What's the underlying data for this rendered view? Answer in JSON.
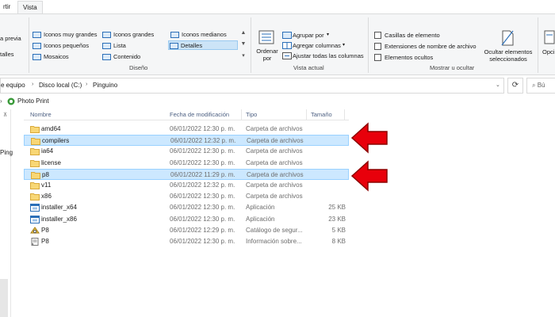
{
  "tabs": [
    "rtir",
    "Vista"
  ],
  "ribbon": {
    "panes": {
      "preview": "a previa",
      "details": "talles"
    },
    "layouts": [
      "Iconos muy grandes",
      "Iconos grandes",
      "Iconos medianos",
      "Iconos pequeños",
      "Lista",
      "Detalles",
      "Mosaicos",
      "Contenido"
    ],
    "layout_selected": "Detalles",
    "group_layout": "Diseño",
    "sort_label": "Ordenar por",
    "group_by": "Agrupar por",
    "add_columns": "Agregar columnas",
    "fit_columns": "Ajustar todas las columnas",
    "group_view": "Vista actual",
    "checkboxes": [
      "Casillas de elemento",
      "Extensiones de nombre de archivo",
      "Elementos ocultos"
    ],
    "hide_selected": "Ocultar elementos seleccionados",
    "group_show": "Mostrar u ocultar",
    "options": "Opci"
  },
  "address": {
    "crumbs": [
      "e equipo",
      "Disco local (C:)",
      "Pinguino"
    ],
    "search_placeholder": "Bú"
  },
  "quick_access": "Photo Print",
  "nav": {
    "partial_label": "Ping"
  },
  "columns": {
    "name": "Nombre",
    "date": "Fecha de modificación",
    "type": "Tipo",
    "size": "Tamaño"
  },
  "files": [
    {
      "name": "amd64",
      "date": "06/01/2022 12:30 p. m.",
      "type": "Carpeta de archivos",
      "size": "",
      "icon": "folder-icon",
      "selected": false
    },
    {
      "name": "compilers",
      "date": "06/01/2022 12:32 p. m.",
      "type": "Carpeta de archivos",
      "size": "",
      "icon": "folder-icon",
      "selected": true
    },
    {
      "name": "ia64",
      "date": "06/01/2022 12:30 p. m.",
      "type": "Carpeta de archivos",
      "size": "",
      "icon": "folder-icon",
      "selected": false
    },
    {
      "name": "license",
      "date": "06/01/2022 12:30 p. m.",
      "type": "Carpeta de archivos",
      "size": "",
      "icon": "folder-icon",
      "selected": false
    },
    {
      "name": "p8",
      "date": "06/01/2022 11:29 p. m.",
      "type": "Carpeta de archivos",
      "size": "",
      "icon": "folder-icon",
      "selected": true
    },
    {
      "name": "v11",
      "date": "06/01/2022 12:32 p. m.",
      "type": "Carpeta de archivos",
      "size": "",
      "icon": "folder-icon",
      "selected": false
    },
    {
      "name": "x86",
      "date": "06/01/2022 12:30 p. m.",
      "type": "Carpeta de archivos",
      "size": "",
      "icon": "folder-icon",
      "selected": false
    },
    {
      "name": "installer_x64",
      "date": "06/01/2022 12:30 p. m.",
      "type": "Aplicación",
      "size": "25 KB",
      "icon": "application-icon",
      "selected": false
    },
    {
      "name": "installer_x86",
      "date": "06/01/2022 12:30 p. m.",
      "type": "Aplicación",
      "size": "23 KB",
      "icon": "application-icon",
      "selected": false
    },
    {
      "name": "P8",
      "date": "06/01/2022 12:29 p. m.",
      "type": "Catálogo de segur...",
      "size": "5 KB",
      "icon": "security-catalog-icon",
      "selected": false
    },
    {
      "name": "P8",
      "date": "06/01/2022 12:30 p. m.",
      "type": "Información sobre...",
      "size": "8 KB",
      "icon": "setup-info-icon",
      "selected": false
    }
  ],
  "colors": {
    "selected_bg": "#cce8ff",
    "arrow": "#e8000b",
    "folder": "#f8d775"
  }
}
